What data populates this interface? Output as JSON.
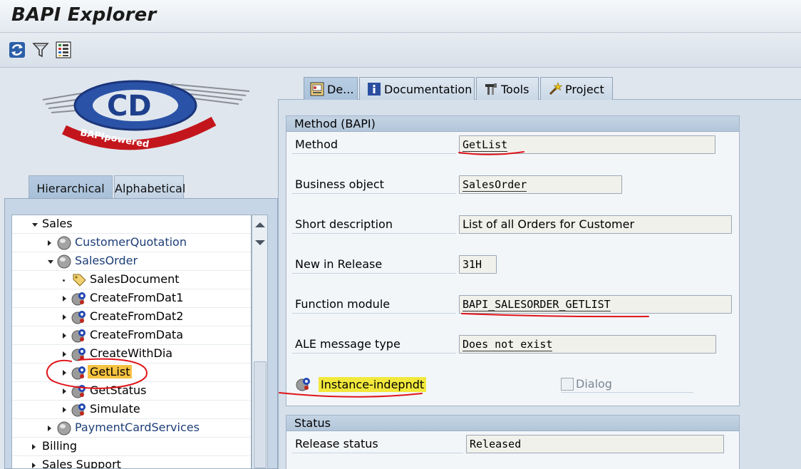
{
  "window": {
    "title": "BAPI Explorer"
  },
  "toolbar": {
    "buttons": [
      "refresh-icon",
      "filter-icon",
      "list-icon"
    ]
  },
  "logo": {
    "text": "BAPIpowered"
  },
  "left_tabs": [
    {
      "label": "Hierarchical",
      "active": true
    },
    {
      "label": "Alphabetical",
      "active": false
    }
  ],
  "tree": [
    {
      "label": "Sales",
      "level": 0,
      "state": "expanded",
      "icon": "none",
      "link": false
    },
    {
      "label": "CustomerQuotation",
      "level": 1,
      "state": "collapsed",
      "icon": "business-object-icon",
      "link": true
    },
    {
      "label": "SalesOrder",
      "level": 1,
      "state": "expanded",
      "icon": "business-object-icon",
      "link": true
    },
    {
      "label": "SalesDocument",
      "level": 2,
      "state": "leaf",
      "icon": "tag-icon",
      "link": false
    },
    {
      "label": "CreateFromDat1",
      "level": 2,
      "state": "collapsed",
      "icon": "method-icon",
      "link": false
    },
    {
      "label": "CreateFromDat2",
      "level": 2,
      "state": "collapsed",
      "icon": "method-icon",
      "link": false
    },
    {
      "label": "CreateFromData",
      "level": 2,
      "state": "collapsed",
      "icon": "method-icon",
      "link": false
    },
    {
      "label": "CreateWithDia",
      "level": 2,
      "state": "collapsed",
      "icon": "method-icon",
      "link": false
    },
    {
      "label": "GetList",
      "level": 2,
      "state": "collapsed",
      "icon": "method-icon",
      "link": false,
      "selected": true
    },
    {
      "label": "GetStatus",
      "level": 2,
      "state": "collapsed",
      "icon": "method-icon",
      "link": false
    },
    {
      "label": "Simulate",
      "level": 2,
      "state": "collapsed",
      "icon": "method-icon",
      "link": false
    },
    {
      "label": "PaymentCardServices",
      "level": 1,
      "state": "collapsed",
      "icon": "business-object-icon",
      "link": true
    },
    {
      "label": "Billing",
      "level": 0,
      "state": "collapsed",
      "icon": "none",
      "link": false
    },
    {
      "label": "Sales Support",
      "level": 0,
      "state": "collapsed",
      "icon": "none",
      "link": false
    }
  ],
  "right_tabs": [
    {
      "label": "De...",
      "icon": "detail-icon",
      "active": true
    },
    {
      "label": "Documentation",
      "icon": "info-icon",
      "active": false
    },
    {
      "label": "Tools",
      "icon": "tools-icon",
      "active": false
    },
    {
      "label": "Project",
      "icon": "wizard-icon",
      "active": false
    }
  ],
  "method_group": {
    "title": "Method (BAPI)",
    "fields": {
      "method": {
        "label": "Method",
        "value": "GetList"
      },
      "business_object": {
        "label": "Business object",
        "value": "SalesOrder"
      },
      "short_description": {
        "label": "Short description",
        "value": "List of all Orders for Customer"
      },
      "new_in_release": {
        "label": "New in Release",
        "value": "31H"
      },
      "function_module": {
        "label": "Function module",
        "value": "BAPI_SALESORDER_GETLIST"
      },
      "ale_message_type": {
        "label": "ALE message type",
        "value": "Does not exist"
      }
    },
    "instance_label": "Instance-indepndt",
    "dialog": {
      "label": "Dialog",
      "checked": false
    }
  },
  "status_group": {
    "title": "Status",
    "release_status": {
      "label": "Release status",
      "value": "Released"
    }
  },
  "colors": {
    "annotation": "#e0141a",
    "highlight": "#f2e83c",
    "selection": "#f5c242",
    "link": "#1d3e78"
  }
}
